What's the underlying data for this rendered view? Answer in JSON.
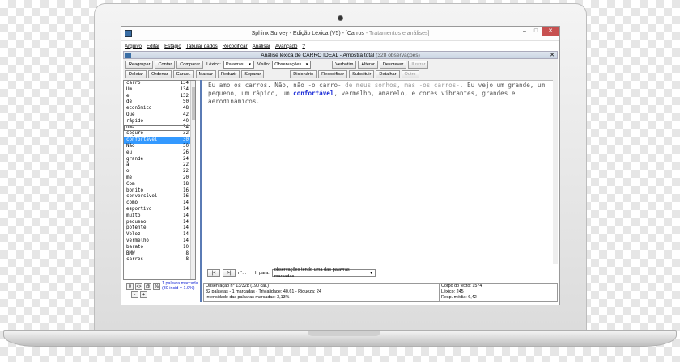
{
  "window": {
    "title_main": "Sphinx Survey - Edição Léxica (V5) - [Carros",
    "title_dim": "- Tratamentos e análises]",
    "minimize": "–",
    "maximize": "□",
    "close": "✕"
  },
  "menu": [
    "Arquivo",
    "Editar",
    "Estágio",
    "Tabular dados",
    "Recodificar",
    "Analisar",
    "Avançado",
    "?"
  ],
  "panel": {
    "title_main": "Análise léxica de CARRO IDEAL - Amostra total",
    "title_dim": "(328 observações)",
    "close": "✕"
  },
  "toolbar": {
    "row1_buttons": [
      "Reagrupar",
      "Contar",
      "Comparar"
    ],
    "lexico_label": "Léxico:",
    "lexico_value": "Palavras",
    "visao_label": "Visão:",
    "visao_value": "Observações",
    "row1_right": [
      {
        "label": "Verbatim",
        "disabled": false
      },
      {
        "label": "Alterar",
        "disabled": false
      },
      {
        "label": "Descrever",
        "disabled": false
      },
      {
        "label": "Ilustrar",
        "disabled": true
      }
    ],
    "row2_buttons": [
      "Deletar",
      "Ordenar",
      "Caract.",
      "Marcar",
      "Reduzir",
      "Separar"
    ],
    "row2_right": [
      {
        "label": "Dicionário",
        "disabled": false
      },
      {
        "label": "Recodificar",
        "disabled": false
      },
      {
        "label": "Substituir",
        "disabled": false
      },
      {
        "label": "Detalhar",
        "disabled": false
      },
      {
        "label": "Outro",
        "disabled": true
      }
    ]
  },
  "wordlist": [
    {
      "word": "carro",
      "count": "134"
    },
    {
      "word": "Um",
      "count": "134"
    },
    {
      "word": "e",
      "count": "132"
    },
    {
      "word": "de",
      "count": "50"
    },
    {
      "word": "econômico",
      "count": "48"
    },
    {
      "word": "Que",
      "count": "42"
    },
    {
      "word": "rápido",
      "count": "40"
    },
    {
      "word": "uma",
      "count": "34"
    },
    {
      "word": "seguro",
      "count": "32"
    },
    {
      "word": "confortável",
      "count": "30"
    },
    {
      "word": "Não",
      "count": "30"
    },
    {
      "word": "eu",
      "count": "26"
    },
    {
      "word": "grande",
      "count": "24"
    },
    {
      "word": "a",
      "count": "22"
    },
    {
      "word": "o",
      "count": "22"
    },
    {
      "word": "me",
      "count": "20"
    },
    {
      "word": "Com",
      "count": "18"
    },
    {
      "word": "bonito",
      "count": "16"
    },
    {
      "word": "conversível",
      "count": "16"
    },
    {
      "word": "como",
      "count": "14"
    },
    {
      "word": "esportivo",
      "count": "14"
    },
    {
      "word": "muito",
      "count": "14"
    },
    {
      "word": "pequeno",
      "count": "14"
    },
    {
      "word": "potente",
      "count": "14"
    },
    {
      "word": "Veloz",
      "count": "14"
    },
    {
      "word": "vermelho",
      "count": "14"
    },
    {
      "word": "barato",
      "count": "10"
    },
    {
      "word": "BMW",
      "count": "8"
    },
    {
      "word": "carros",
      "count": "8"
    }
  ],
  "text": {
    "s1": "Eu amo os carros. Não, não -o carro-",
    "s2": " de meus sonhos, mas -os carros-.",
    "s3": " Eu vejo um grande, um pequeno, um rápido, um ",
    "highlight": "confortável",
    "s4": ", vermelho, amarelo, e cores vibrantes, grandes e aerodinâmicos."
  },
  "nav": {
    "prev": "|<",
    "next": ">|",
    "other": "n°...",
    "ir_label": "Ir para:",
    "select_value": "observações tendo uma das palavras marcadas"
  },
  "left_bottom": {
    "btn1": "0",
    "btn2": "<>",
    "btn3": "@",
    "btn4": "%",
    "btn5": "-",
    "btn6": "+",
    "info1": "1 palavra marcada",
    "info2": "(30 incid = 1.9%)"
  },
  "status": {
    "line1": "Observação n° 13/328 (190 car.)",
    "line2": "32 palavras - 1 marcadas - Trivialidade: 40,61 - Riqueza: 24",
    "line3": "Intensidade das palavras marcadas: 3,13%",
    "r1": "Corpo do texto: 1574",
    "r2": "Léxico: 245",
    "r3": "Resp. média: 6,42"
  }
}
